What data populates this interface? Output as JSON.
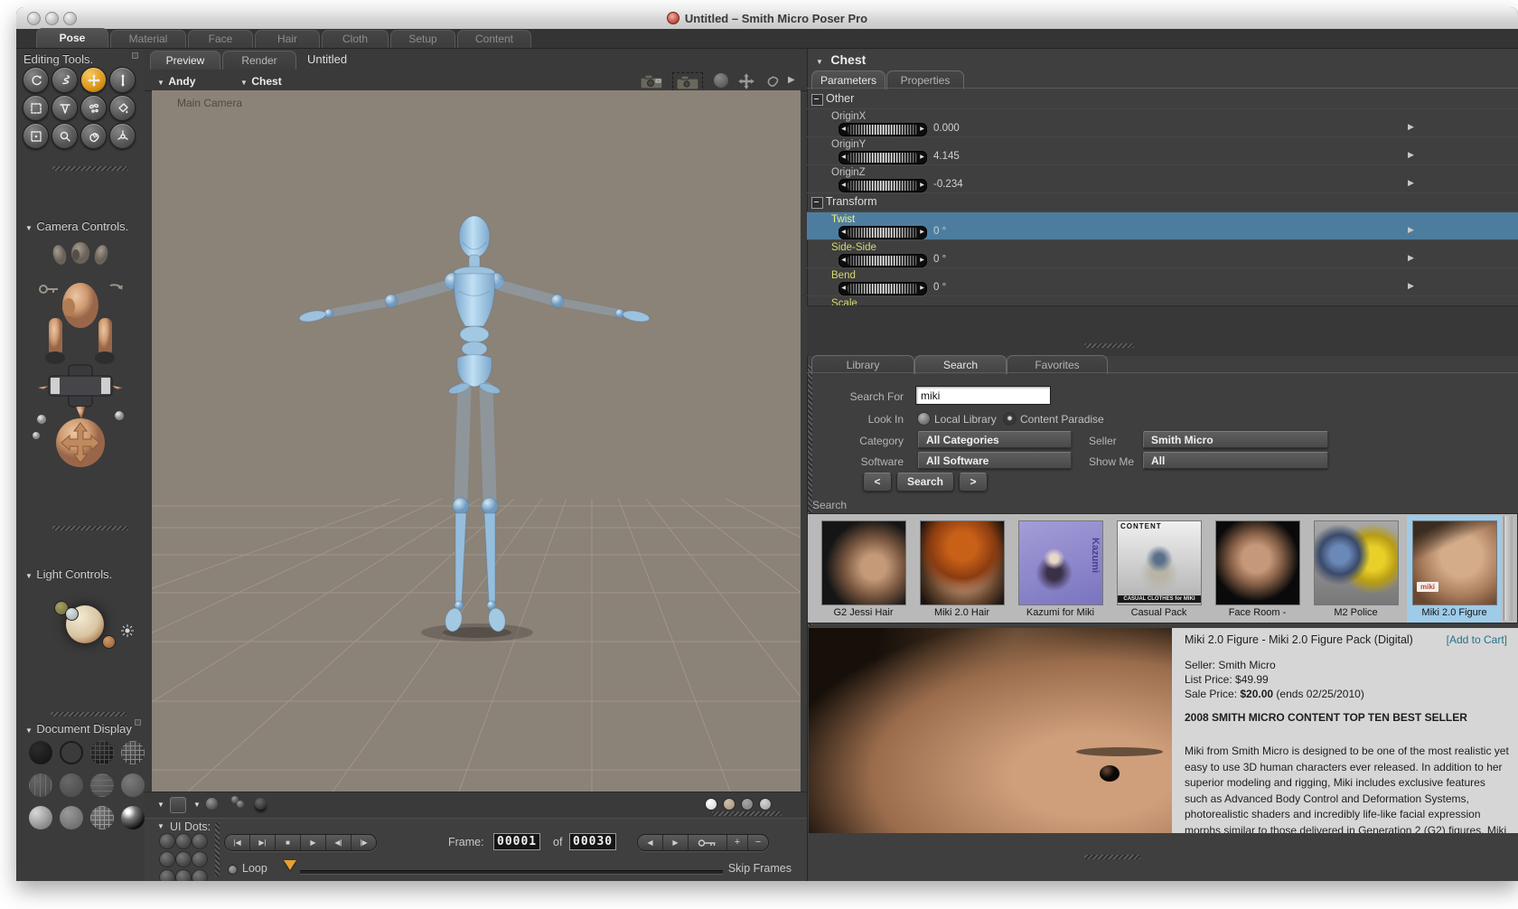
{
  "window": {
    "title": "Untitled – Smith Micro Poser Pro"
  },
  "app_tabs": [
    {
      "label": "Pose"
    },
    {
      "label": "Material"
    },
    {
      "label": "Face"
    },
    {
      "label": "Hair"
    },
    {
      "label": "Cloth"
    },
    {
      "label": "Setup"
    },
    {
      "label": "Content"
    }
  ],
  "sidebar": {
    "editing_tools_label": "Editing Tools.",
    "camera_controls_label": "Camera Controls.",
    "light_controls_label": "Light Controls.",
    "document_display_label": "Document Display"
  },
  "viewport": {
    "preview_tab": "Preview",
    "render_tab": "Render",
    "doc_title": "Untitled",
    "figure_menu": "Andy",
    "actor_menu": "Chest",
    "camera_label": "Main Camera"
  },
  "params": {
    "header": "Chest",
    "parameters_tab": "Parameters",
    "properties_tab": "Properties",
    "group_other": "Other",
    "group_transform": "Transform",
    "rows": [
      {
        "label": "OriginX",
        "value": "0.000"
      },
      {
        "label": "OriginY",
        "value": "4.145"
      },
      {
        "label": "OriginZ",
        "value": "-0.234"
      },
      {
        "label": "Twist",
        "value": "0 °"
      },
      {
        "label": "Side-Side",
        "value": "0 °"
      },
      {
        "label": "Bend",
        "value": "0 °"
      },
      {
        "label": "Scale",
        "value": ""
      }
    ]
  },
  "library": {
    "library_tab": "Library",
    "search_tab": "Search",
    "favorites_tab": "Favorites",
    "search_for_label": "Search For",
    "search_value": "miki",
    "look_in_label": "Look In",
    "radio_local": "Local Library",
    "radio_content": "Content Paradise",
    "category_label": "Category",
    "category_value": "All Categories",
    "seller_label": "Seller",
    "seller_value": "Smith Micro",
    "software_label": "Software",
    "software_value": "All Software",
    "show_me_label": "Show Me",
    "show_me_value": "All",
    "prev_button": "<",
    "search_button": "Search",
    "next_button": ">",
    "results_label": "Search",
    "thumbnails": [
      {
        "label": "G2 Jessi Hair"
      },
      {
        "label": "Miki 2.0 Hair"
      },
      {
        "label": "Kazumi for Miki",
        "art_text": "Kazumi"
      },
      {
        "label": "Casual Pack",
        "art_top": "CONTENT",
        "art_banner": "CASUAL CLOTHES for MIKI"
      },
      {
        "label": "Face Room -"
      },
      {
        "label": "M2 Police"
      },
      {
        "label": "Miki 2.0 Figure",
        "art_logo": "miki"
      }
    ],
    "detail": {
      "title": "Miki 2.0 Figure - Miki 2.0 Figure Pack (Digital)",
      "add_to_cart": "[Add to Cart]",
      "seller_line": "Seller: Smith Micro",
      "list_price_line": "List Price: $49.99",
      "sale_price_label": "Sale Price:",
      "sale_price_value": "$20.00",
      "sale_price_note": "(ends 02/25/2010)",
      "banner": "2008 SMITH MICRO CONTENT TOP TEN BEST SELLER",
      "description": "Miki from Smith Micro is designed to be one of the most realistic yet easy to use 3D human characters ever released. In addition to her superior modeling and rigging, Miki includes exclusive features such as Advanced Body Control and Deformation Systems, photorealistic shaders and incredibly life-like facial expression morphs similar to those delivered in Generation 2 (G2) figures. Miki is Poser Face Room compatible, and is one of the most advanced characters to ship with Poser to date."
    }
  },
  "timeline": {
    "ui_dots_label": "UI Dots:",
    "frame_label": "Frame:",
    "frame_current": "00001",
    "of_label": "of",
    "frame_total": "00030",
    "loop_label": "Loop",
    "skip_frames_label": "Skip Frames"
  },
  "icons": {
    "disclosure_down": "▼",
    "collapse_right": "▶",
    "dial_left": "◀",
    "dial_right": "▶",
    "row_arrow": "▶",
    "t_start": "|◀",
    "t_end": "▶|",
    "t_stop": "■",
    "t_play": "▶",
    "t_stepback": "◀|",
    "t_stepfwd": "|▶",
    "t_back": "◀",
    "t_fwd": "▶",
    "t_plus": "+",
    "t_minus": "−"
  },
  "colors": {
    "accent_orange": "#e09a28",
    "selection_blue": "#4d7d9e",
    "tile_selected": "#9ecbe8",
    "link_teal": "#1a6b8a",
    "param_yellow": "#d6d86e"
  }
}
